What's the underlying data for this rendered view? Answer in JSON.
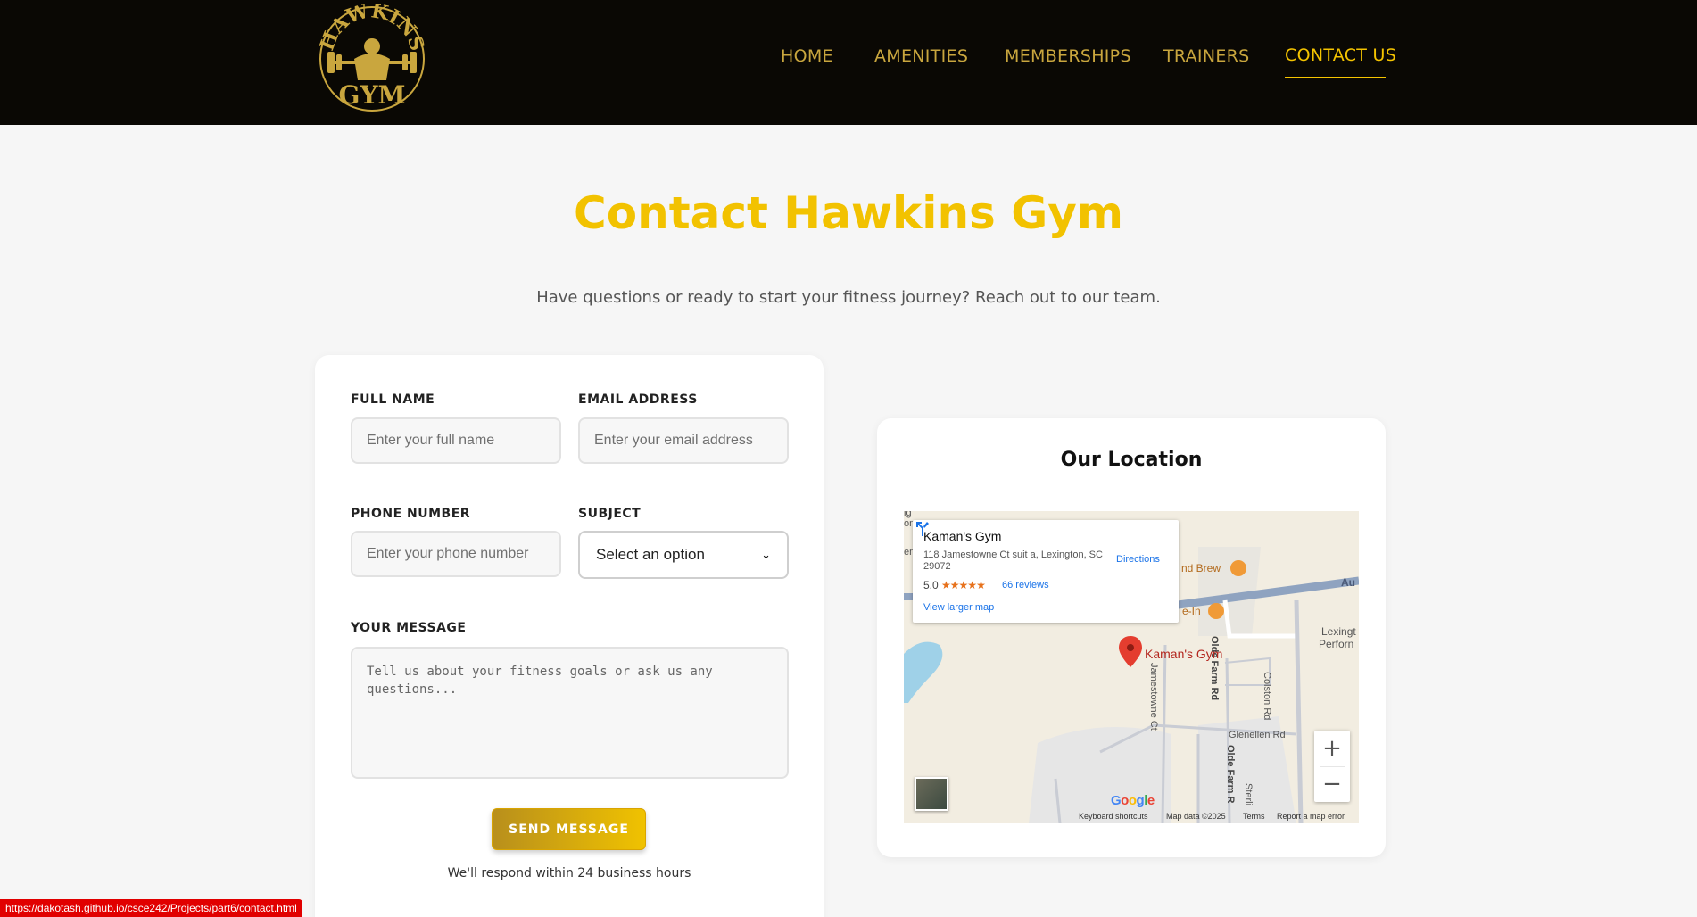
{
  "header": {
    "logo_text_top": "HAWKINS",
    "logo_text_bottom": "GYM",
    "nav": [
      {
        "label": "HOME"
      },
      {
        "label": "AMENITIES"
      },
      {
        "label": "MEMBERSHIPS"
      },
      {
        "label": "TRAINERS"
      },
      {
        "label": "CONTACT US",
        "active": true
      }
    ]
  },
  "hero": {
    "title": "Contact Hawkins Gym",
    "subtitle": "Have questions or ready to start your fitness journey? Reach out to our team."
  },
  "form": {
    "full_name": {
      "label": "FULL NAME",
      "placeholder": "Enter your full name"
    },
    "email": {
      "label": "EMAIL ADDRESS",
      "placeholder": "Enter your email address"
    },
    "phone": {
      "label": "PHONE NUMBER",
      "placeholder": "Enter your phone number"
    },
    "subject": {
      "label": "SUBJECT",
      "value": "Select an option"
    },
    "message": {
      "label": "YOUR MESSAGE",
      "placeholder": "Tell us about your fitness goals or ask us any questions..."
    },
    "send_label": "SEND MESSAGE",
    "note": "We'll respond within 24 business hours"
  },
  "location": {
    "title": "Our Location",
    "map": {
      "place_name": "Kaman's Gym",
      "address": "118 Jamestowne Ct suit a, Lexington, SC 29072",
      "rating": "5.0",
      "stars": "★★★★★",
      "reviews": "66 reviews",
      "view_larger": "View larger map",
      "directions": "Directions",
      "pin_label": "Kaman's Gym",
      "labels": {
        "brew": "nd Brew",
        "inn": "e-In",
        "au": "Au",
        "lexington": "Lexingt",
        "perform": "Perforn",
        "olde_farm_top": "Olde Farm Rd",
        "olde_farm_bottom": "Olde Farm R",
        "jamestowne": "Jamestowne Ct",
        "colston": "Colston Rd",
        "glenellen": "Glenellen Rd",
        "sterling": "Sterli",
        "left_edge_1": "ig",
        "left_edge_2": "on",
        "left_edge_3": "en"
      },
      "google": "Google",
      "footer": {
        "shortcuts": "Keyboard shortcuts",
        "mapdata": "Map data ©2025",
        "terms": "Terms",
        "report": "Report a map error"
      }
    }
  },
  "status_bar": "https://dakotash.github.io/csce242/Projects/part6/contact.html",
  "colors": {
    "accent": "#f2c200",
    "nav_gold": "#c9a63e",
    "header_bg": "#0a0804"
  }
}
